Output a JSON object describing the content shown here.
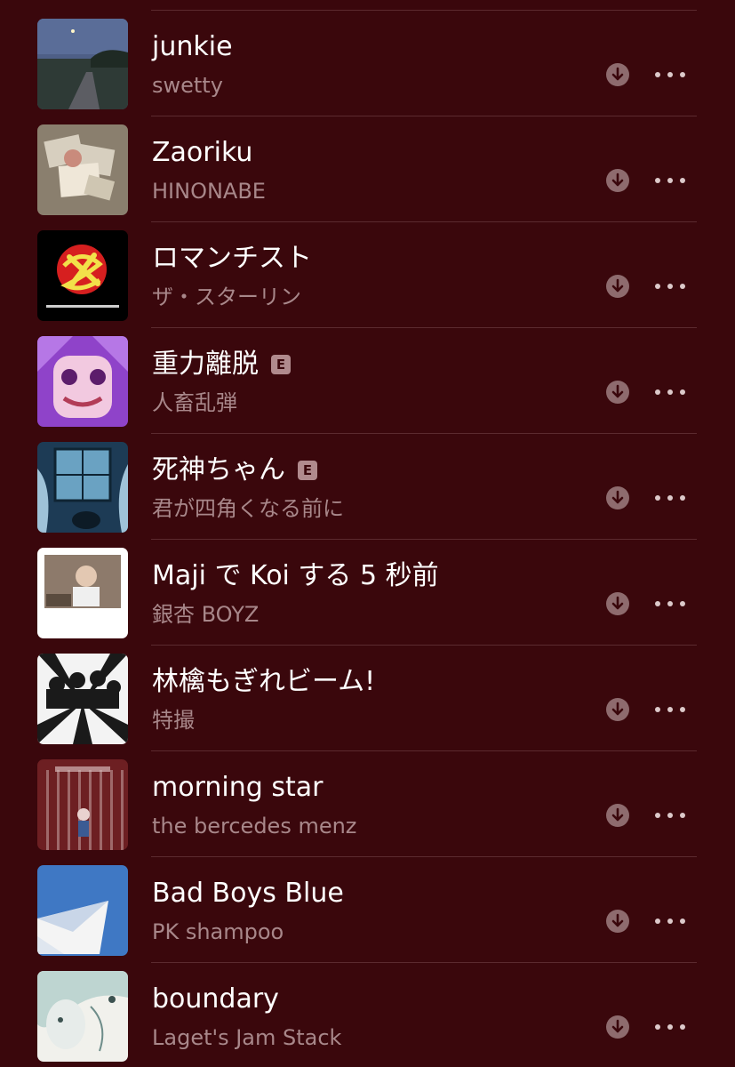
{
  "songs": [
    {
      "title": "junkie",
      "artist": "swetty",
      "explicit": false,
      "artwork": "art-dusk-road",
      "colors": [
        "#3b4a6a",
        "#2e3a36"
      ]
    },
    {
      "title": "Zaoriku",
      "artist": "HINONABE",
      "explicit": false,
      "artwork": "art-photo-collage",
      "colors": [
        "#8a7f6e",
        "#d7cfbf"
      ]
    },
    {
      "title": "ロマンチスト",
      "artist": "ザ・スターリン",
      "explicit": false,
      "artwork": "art-stalin-logo",
      "colors": [
        "#000000",
        "#d61f1f"
      ]
    },
    {
      "title": "重力離脱",
      "artist": "人畜乱弾",
      "explicit": true,
      "artwork": "art-purple-anime-face",
      "colors": [
        "#8f43c9",
        "#f2c9e0"
      ]
    },
    {
      "title": "死神ちゃん",
      "artist": "君が四角くなる前に",
      "explicit": true,
      "artwork": "art-blue-room",
      "colors": [
        "#1d3b55",
        "#6aa2c2"
      ]
    },
    {
      "title": "Maji で Koi する 5 秒前",
      "artist": "銀杏 BOYZ",
      "explicit": false,
      "artwork": "art-polaroid-photo",
      "colors": [
        "#ffffff",
        "#8d7a6b"
      ]
    },
    {
      "title": "林檎もぎれビーム!",
      "artist": "特撮",
      "explicit": false,
      "artwork": "art-band-burst",
      "colors": [
        "#1a1a1a",
        "#f3f3f3"
      ]
    },
    {
      "title": "morning star",
      "artist": "the bercedes menz",
      "explicit": false,
      "artwork": "art-red-stripes",
      "colors": [
        "#6d1f22",
        "#c8a6a6"
      ]
    },
    {
      "title": "Bad Boys Blue",
      "artist": "PK shampoo",
      "explicit": false,
      "artwork": "art-blue-paper-plane",
      "colors": [
        "#3f78c4",
        "#f4f4f4"
      ]
    },
    {
      "title": "boundary",
      "artist": "Laget's Jam Stack",
      "explicit": false,
      "artwork": "art-teal-sketch",
      "colors": [
        "#a8c9c6",
        "#f1f1ec"
      ]
    }
  ],
  "labels": {
    "explicit_badge": "E"
  },
  "icons": {
    "download": "download-icon",
    "more": "more-icon"
  },
  "theme": {
    "background": "#3a070c",
    "title": "#ffffff",
    "subtitle": "#a8878a",
    "download_circle": "#8e6b6e",
    "dots": "#dcc9ca",
    "divider": "#5b2a2f"
  }
}
